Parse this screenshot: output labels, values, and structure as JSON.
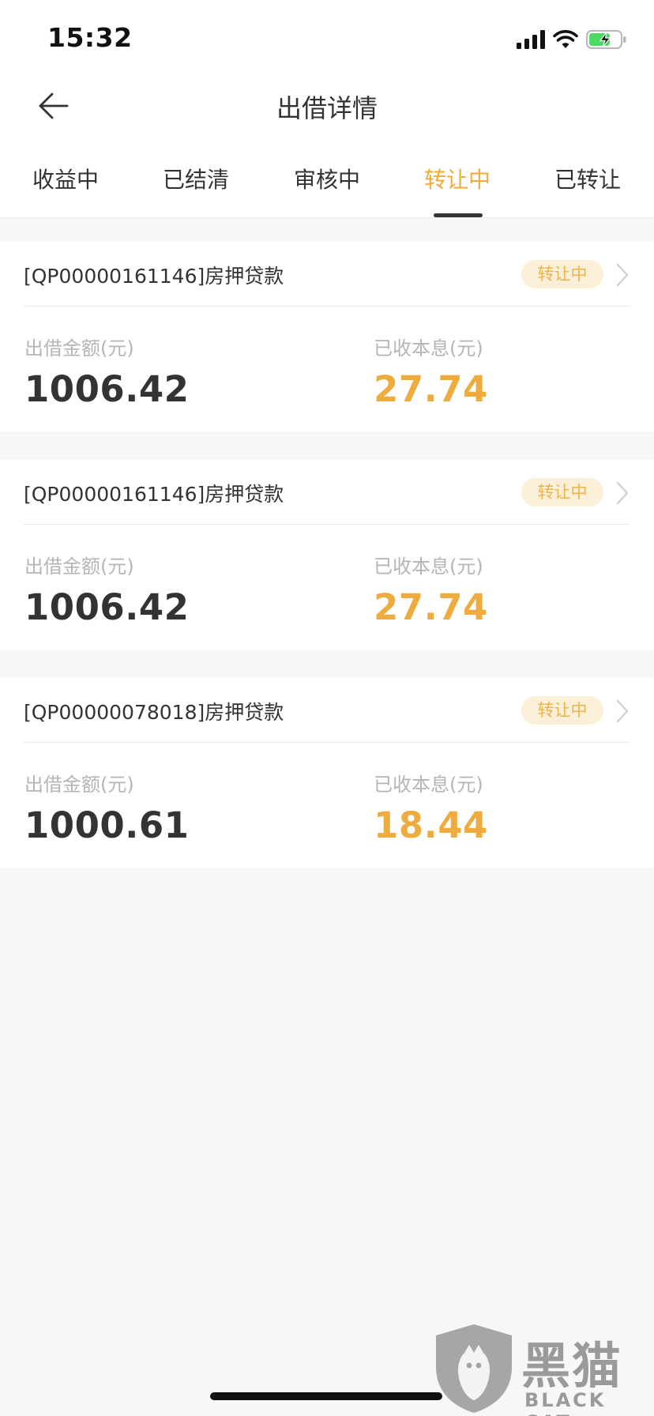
{
  "status_bar": {
    "time": "15:32"
  },
  "nav": {
    "title": "出借详情"
  },
  "tabs": [
    {
      "label": "收益中",
      "active": false
    },
    {
      "label": "已结清",
      "active": false
    },
    {
      "label": "审核中",
      "active": false
    },
    {
      "label": "转让中",
      "active": true
    },
    {
      "label": "已转让",
      "active": false
    }
  ],
  "cards": [
    {
      "title": "[QP00000161146]房押贷款",
      "badge": "转让中",
      "amount_label": "出借金额(元)",
      "amount": "1006.42",
      "income_label": "已收本息(元)",
      "income": "27.74"
    },
    {
      "title": "[QP00000161146]房押贷款",
      "badge": "转让中",
      "amount_label": "出借金额(元)",
      "amount": "1006.42",
      "income_label": "已收本息(元)",
      "income": "27.74"
    },
    {
      "title": "[QP00000078018]房押贷款",
      "badge": "转让中",
      "amount_label": "出借金额(元)",
      "amount": "1000.61",
      "income_label": "已收本息(元)",
      "income": "18.44"
    }
  ],
  "watermark": {
    "brand_cn": "黑猫",
    "brand_en": "BLACK CAT"
  },
  "colors": {
    "accent": "#f0ac3d",
    "badge_bg": "#fbf0d7",
    "label_gray": "#b5b5b5",
    "page_bg": "#f7f7f7"
  },
  "icons": [
    "back-arrow-icon",
    "signal-icon",
    "wifi-icon",
    "battery-charging-icon",
    "chevron-right-icon"
  ]
}
